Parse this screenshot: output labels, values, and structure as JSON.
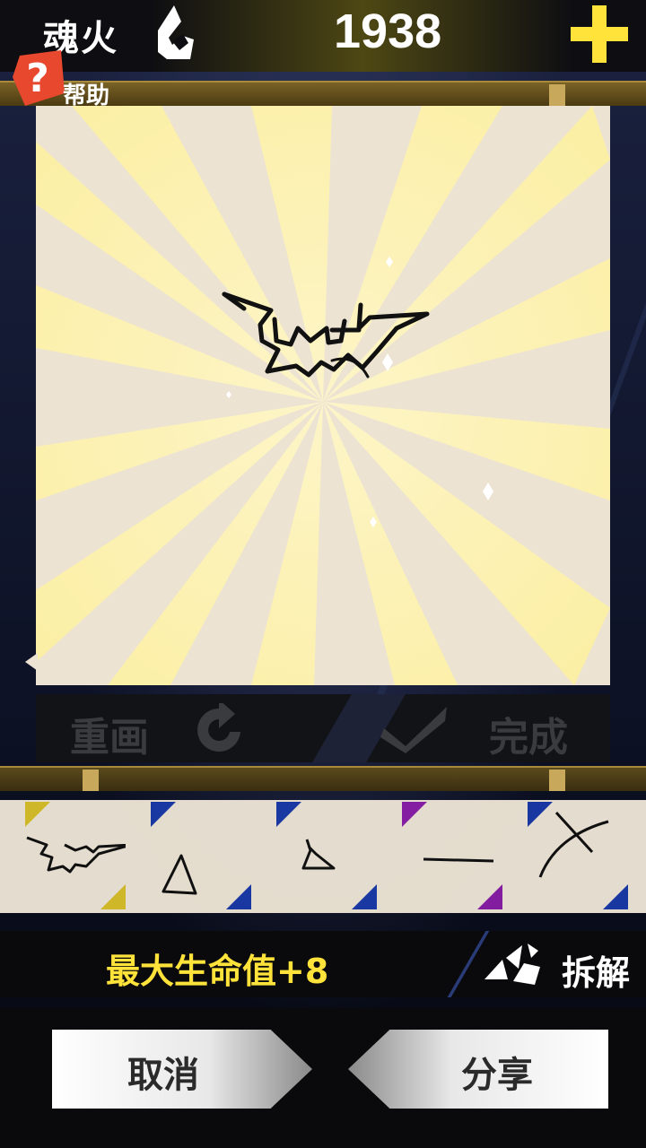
{
  "header": {
    "currency_label": "魂火",
    "currency_value": "1938",
    "soul_icon": "soul-flame-icon",
    "add_icon": "plus-icon"
  },
  "help": {
    "icon": "question-mark-icon",
    "label": "帮助"
  },
  "draw_controls": {
    "redo_label": "重画",
    "redo_icon": "redo-arrow-icon",
    "done_icon": "checkmark-icon",
    "done_label": "完成"
  },
  "sketch_tray": {
    "slots": [
      {
        "name": "bat",
        "corner_color": "#d9c22a"
      },
      {
        "name": "triangle",
        "corner_color": "#1a3aa8"
      },
      {
        "name": "small-triangle",
        "corner_color": "#1a3aa8"
      },
      {
        "name": "line",
        "corner_color": "#8a1ea8"
      },
      {
        "name": "x-mark",
        "corner_color": "#1a3aa8"
      }
    ]
  },
  "result": {
    "stat_text": "最大生命值+8",
    "dismantle_icon": "shatter-icon",
    "dismantle_label": "拆解"
  },
  "actions": {
    "cancel_label": "取消",
    "share_label": "分享"
  },
  "colors": {
    "accent_yellow": "#ffe23a",
    "canvas": "#ece3d2",
    "tray_blue": "#1a3aa8",
    "tray_purple": "#8a1ea8",
    "tray_gold": "#d9c22a"
  }
}
